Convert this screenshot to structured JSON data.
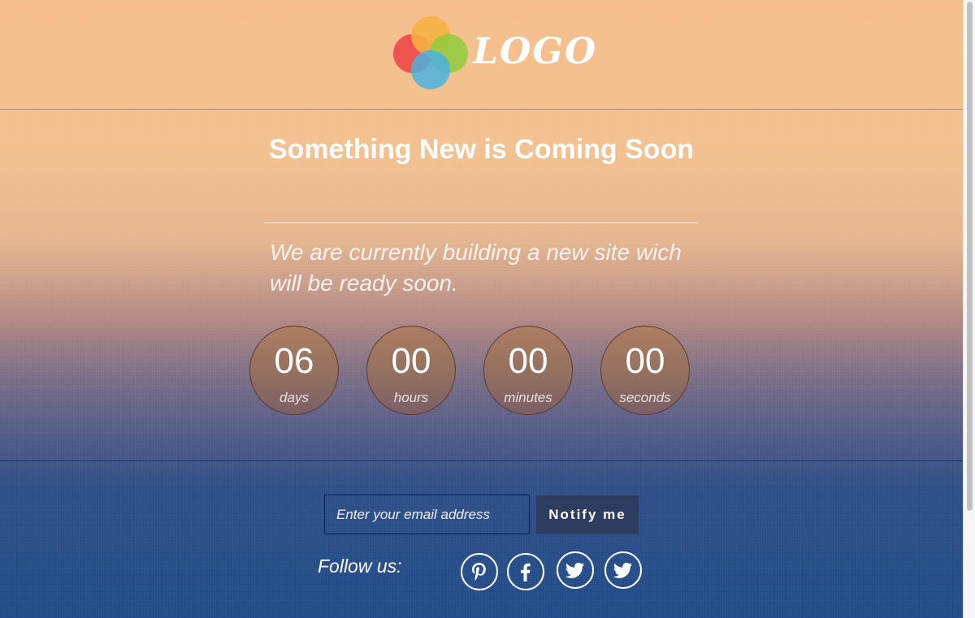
{
  "brand": {
    "logo_text": "LOGO"
  },
  "hero": {
    "headline": "Something New is Coming Soon",
    "subtitle": "We are currently building a new site wich will be ready soon."
  },
  "countdown": [
    {
      "value": "06",
      "unit": "days"
    },
    {
      "value": "00",
      "unit": "hours"
    },
    {
      "value": "00",
      "unit": "minutes"
    },
    {
      "value": "00",
      "unit": "seconds"
    }
  ],
  "subscribe": {
    "placeholder": "Enter your email address",
    "button_label": "Notify me"
  },
  "social": {
    "label": "Follow us:",
    "icons": [
      "pinterest-icon",
      "facebook-icon",
      "twitter-icon",
      "twitter-icon"
    ]
  },
  "colors": {
    "circle_fill": "#93705f",
    "button_bg": "#2e3c60",
    "logo_red": "#ee4444",
    "logo_orange": "#f6b042",
    "logo_green": "#8fcb3b",
    "logo_blue": "#4ab1e0"
  }
}
